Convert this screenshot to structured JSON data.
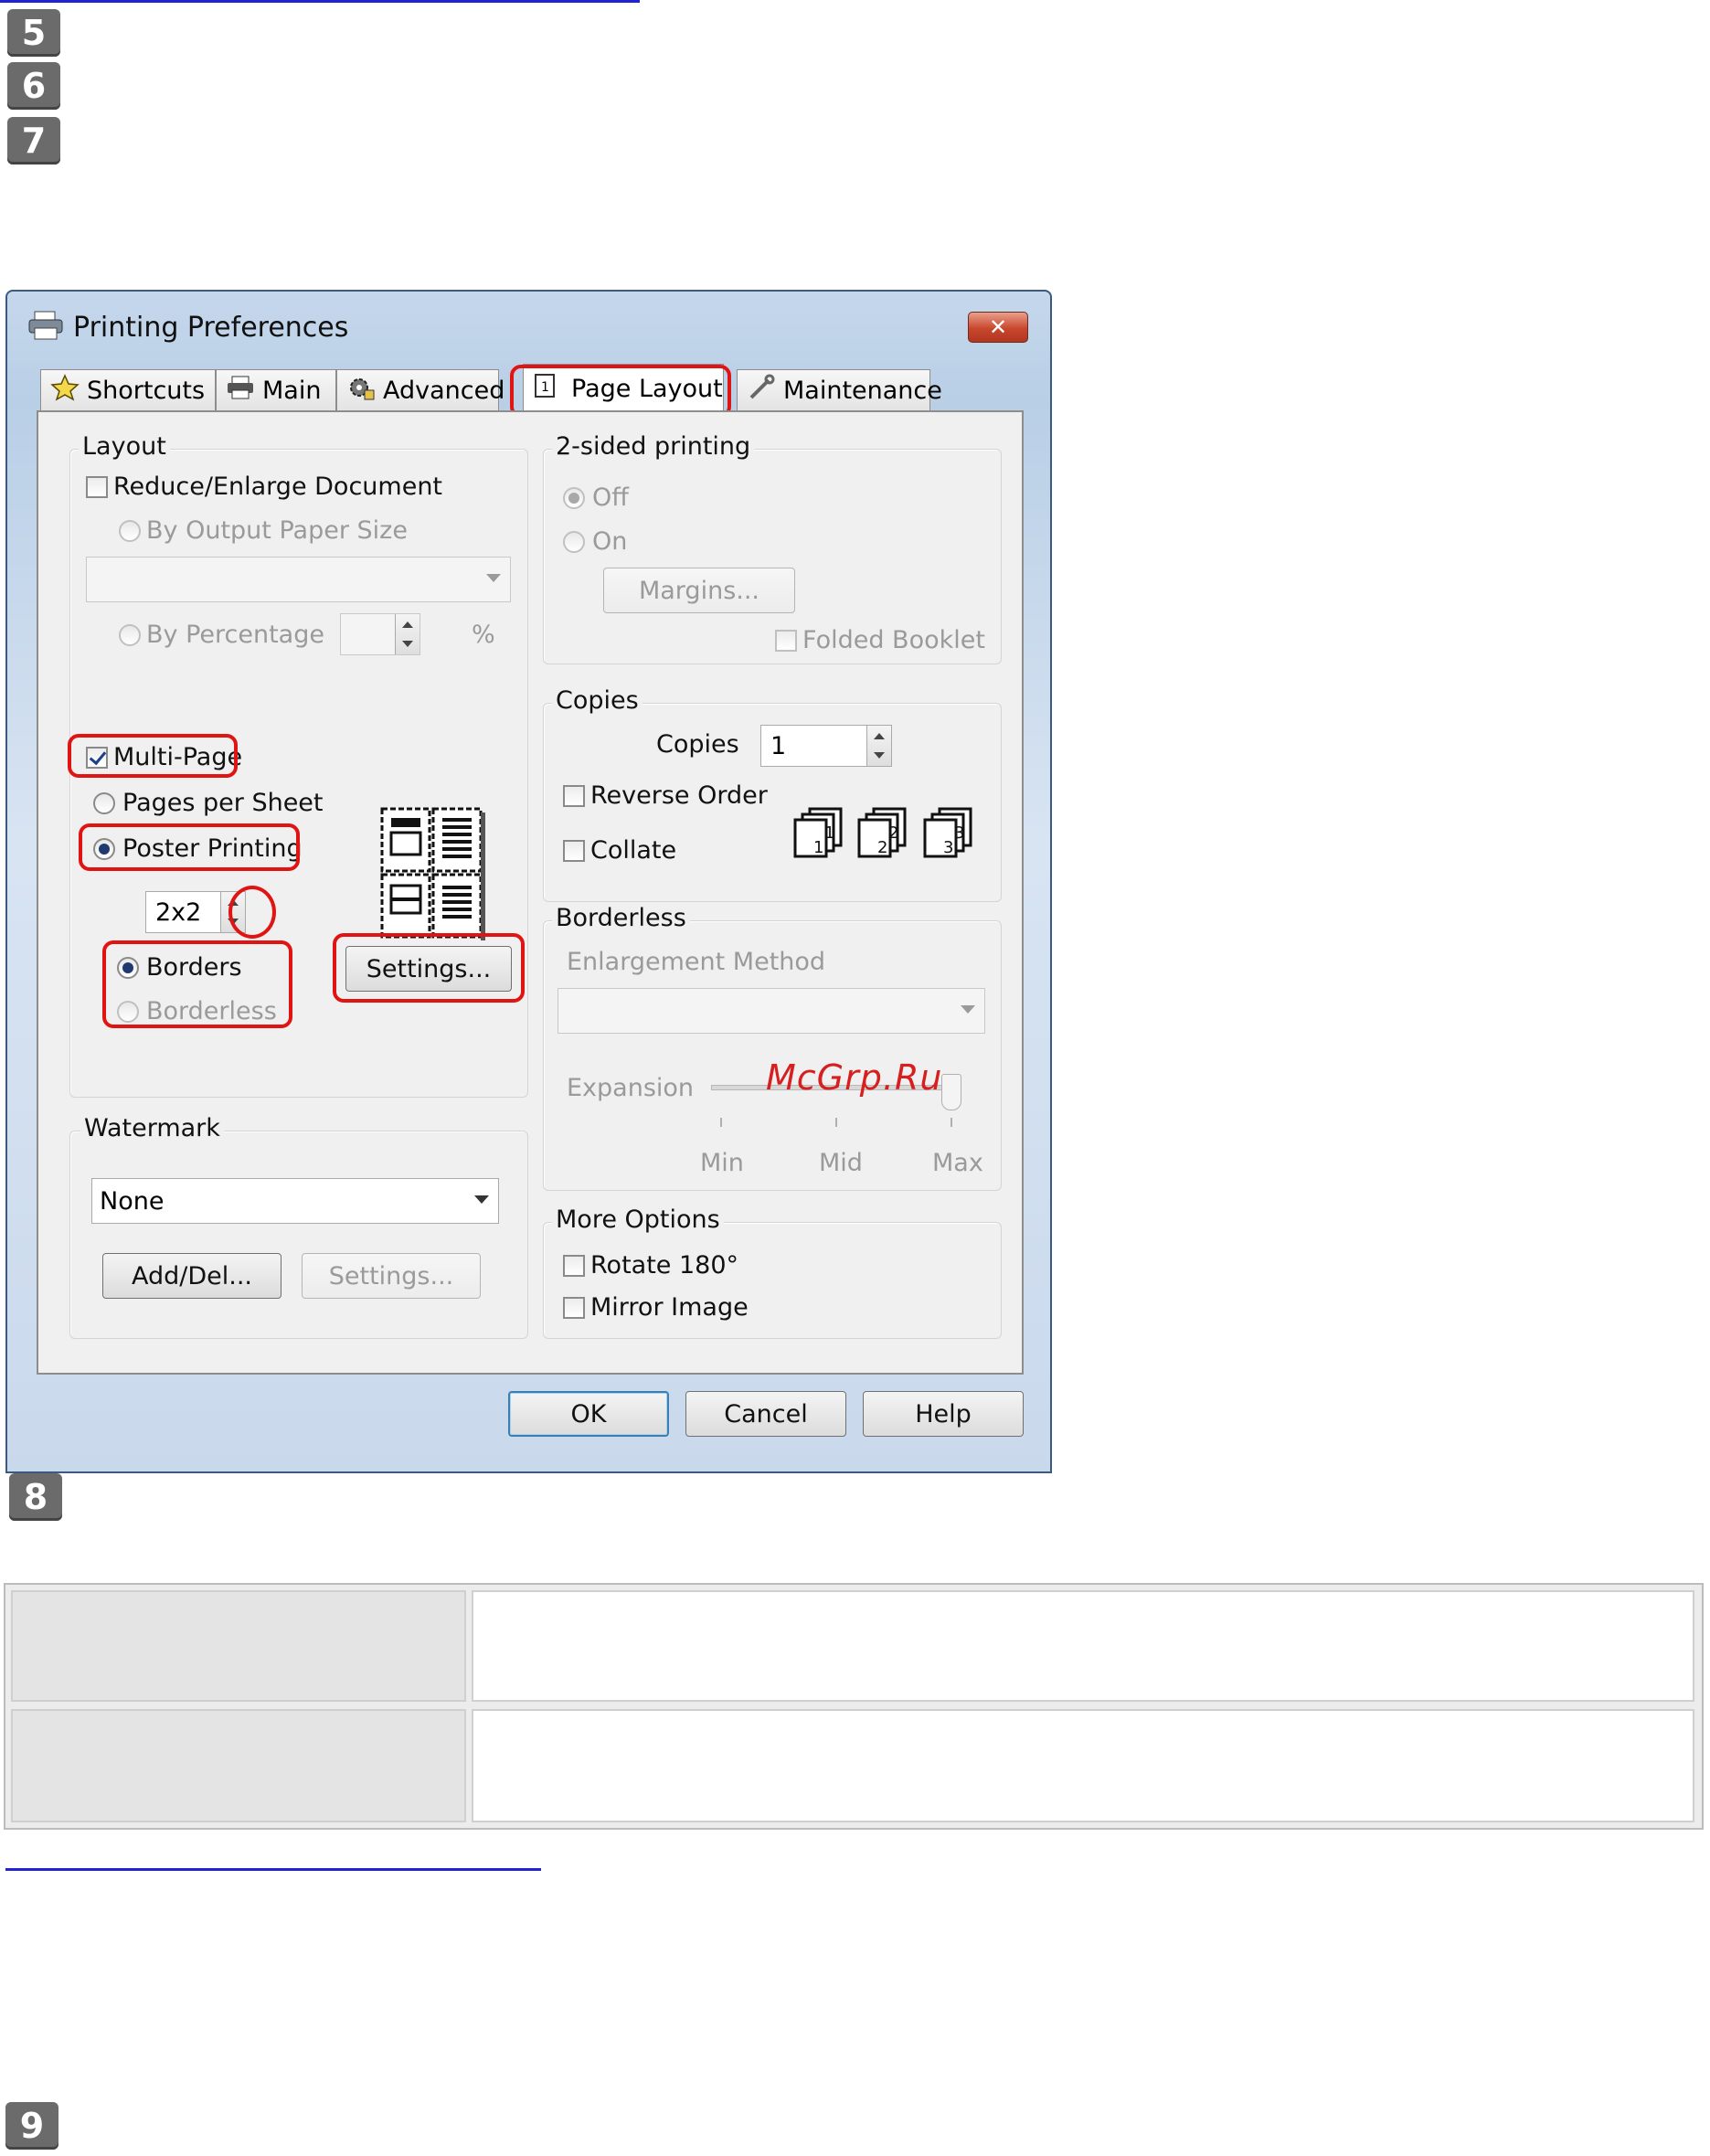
{
  "steps": [
    "5",
    "6",
    "7",
    "8",
    "9"
  ],
  "dialog": {
    "title": "Printing Preferences",
    "close_label": "✕",
    "tabs": [
      {
        "label": "Shortcuts",
        "icon": "star-icon"
      },
      {
        "label": "Main",
        "icon": "printer-icon"
      },
      {
        "label": "Advanced",
        "icon": "gear-icon"
      },
      {
        "label": "Page Layout",
        "icon": "page-icon",
        "active": true
      },
      {
        "label": "Maintenance",
        "icon": "wrench-icon"
      }
    ],
    "layout": {
      "title": "Layout",
      "reduce_enlarge": "Reduce/Enlarge Document",
      "by_output_paper_size": "By Output Paper Size",
      "by_percentage": "By Percentage",
      "percent_sign": "%",
      "multi_page": "Multi-Page",
      "pages_per_sheet": "Pages per Sheet",
      "poster_printing": "Poster Printing",
      "poster_value": "2x2",
      "borders": "Borders",
      "borderless": "Borderless",
      "settings_button": "Settings..."
    },
    "watermark": {
      "title": "Watermark",
      "value": "None",
      "add_del_button": "Add/Del...",
      "settings_button": "Settings..."
    },
    "two_sided": {
      "title": "2-sided printing",
      "off": "Off",
      "on": "On",
      "margins_button": "Margins...",
      "folded_booklet": "Folded Booklet"
    },
    "copies": {
      "title": "Copies",
      "copies_label": "Copies",
      "copies_value": "1",
      "reverse_order": "Reverse Order",
      "collate": "Collate"
    },
    "borderless": {
      "title": "Borderless",
      "enlargement_method": "Enlargement Method",
      "expansion": "Expansion",
      "min": "Min",
      "mid": "Mid",
      "max": "Max"
    },
    "more_options": {
      "title": "More Options",
      "rotate": "Rotate 180°",
      "mirror": "Mirror Image"
    },
    "buttons": {
      "ok": "OK",
      "cancel": "Cancel",
      "help": "Help"
    }
  },
  "watermark_overlay": "McGrp.Ru",
  "colors": {
    "highlight": "#e11414",
    "link": "#2323d6",
    "step_badge": "#6b6b6b"
  }
}
